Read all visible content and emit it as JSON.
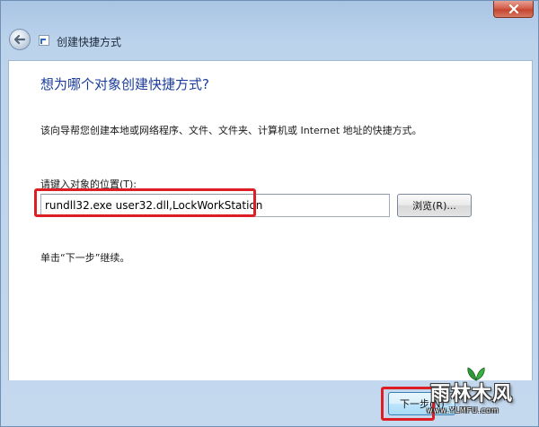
{
  "window": {
    "title": "创建快捷方式",
    "close_icon": "close-icon",
    "back_icon": "back-arrow-icon",
    "app_icon": "shortcut-icon"
  },
  "wizard": {
    "heading": "想为哪个对象创建快捷方式?",
    "description": "该向导帮您创建本地或网络程序、文件、文件夹、计算机或 Internet 地址的快捷方式。",
    "location_label": "请键入对象的位置(T):",
    "location_value": "rundll32.exe user32.dll,LockWorkStation",
    "browse_label": "浏览(R)...",
    "hint": "单击“下一步”继续。",
    "next_label": "下一步(N)"
  },
  "watermark": {
    "text": "雨林木风",
    "url": "www.YLMFU.com"
  },
  "colors": {
    "heading": "#1b3d9a",
    "highlight": "#dd1f25"
  }
}
